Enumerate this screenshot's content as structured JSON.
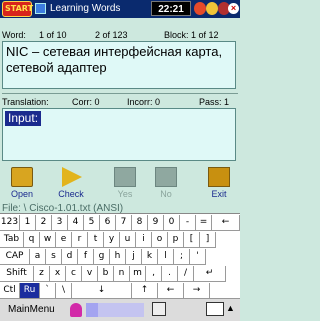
{
  "titlebar": {
    "start": "START",
    "title": "Learning Words",
    "clock": "22:21"
  },
  "status": {
    "word_label": "Word:",
    "word_index": "1 of 10",
    "of_total": "2 of 123",
    "block": "Block:  1 of 12",
    "translation_label": "Translation:",
    "corr": "Corr: 0",
    "incorr": "Incorr: 0",
    "pass": "Pass: 1"
  },
  "word_text": "NIC – сетевая интерфейсная карта, сетевой адаптер",
  "input_label": "Input:",
  "actions": {
    "open": "Open",
    "check": "Check",
    "yes": "Yes",
    "no": "No",
    "exit": "Exit"
  },
  "file": "File: \\ Cisco-1.01.txt (ANSI)",
  "keyboard": {
    "row1": [
      "123",
      "1",
      "2",
      "3",
      "4",
      "5",
      "6",
      "7",
      "8",
      "9",
      "0",
      "-",
      "=",
      "←"
    ],
    "row2": [
      "Tab",
      "q",
      "w",
      "e",
      "r",
      "t",
      "y",
      "u",
      "i",
      "o",
      "p",
      "[",
      "]"
    ],
    "row3": [
      "CAP",
      "a",
      "s",
      "d",
      "f",
      "g",
      "h",
      "j",
      "k",
      "l",
      ";",
      "'"
    ],
    "row4": [
      "Shift",
      "z",
      "x",
      "c",
      "v",
      "b",
      "n",
      "m",
      ",",
      ".",
      "/",
      "↵"
    ],
    "row5": [
      "Ctl",
      "Ru",
      "`",
      "\\",
      "↓",
      "↑",
      "←",
      "→"
    ]
  },
  "bottom": {
    "menu": "MainMenu"
  }
}
